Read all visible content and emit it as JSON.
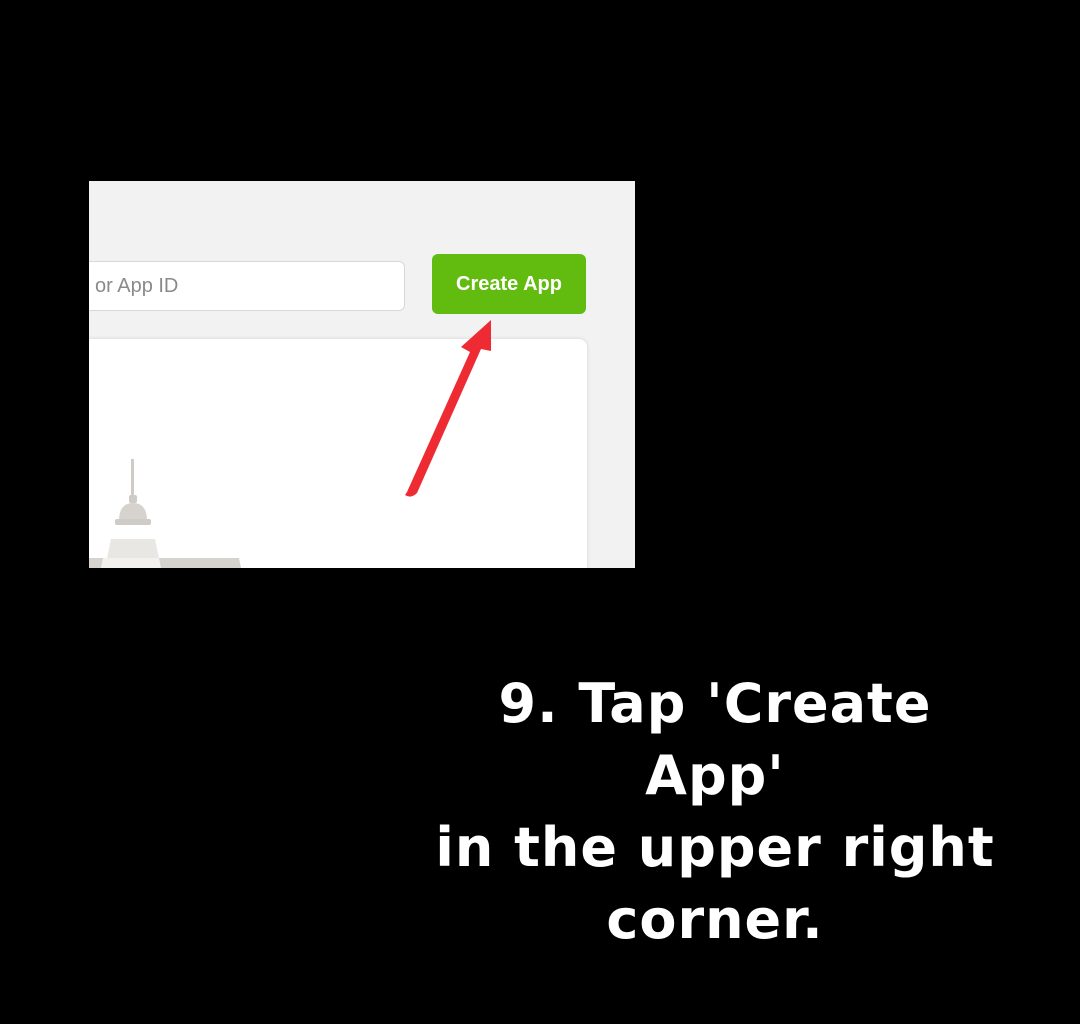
{
  "screenshot": {
    "search": {
      "text": "or App ID"
    },
    "create_button": {
      "label": "Create App",
      "color": "#62bb0f"
    },
    "arrow": {
      "color": "#ee2b33",
      "icon": "arrow-icon"
    },
    "illustration": {
      "icon": "desk-lamp-icon"
    }
  },
  "caption": {
    "line1": "9. Tap 'Create App'",
    "line2": "in the upper right",
    "line3": "corner."
  }
}
